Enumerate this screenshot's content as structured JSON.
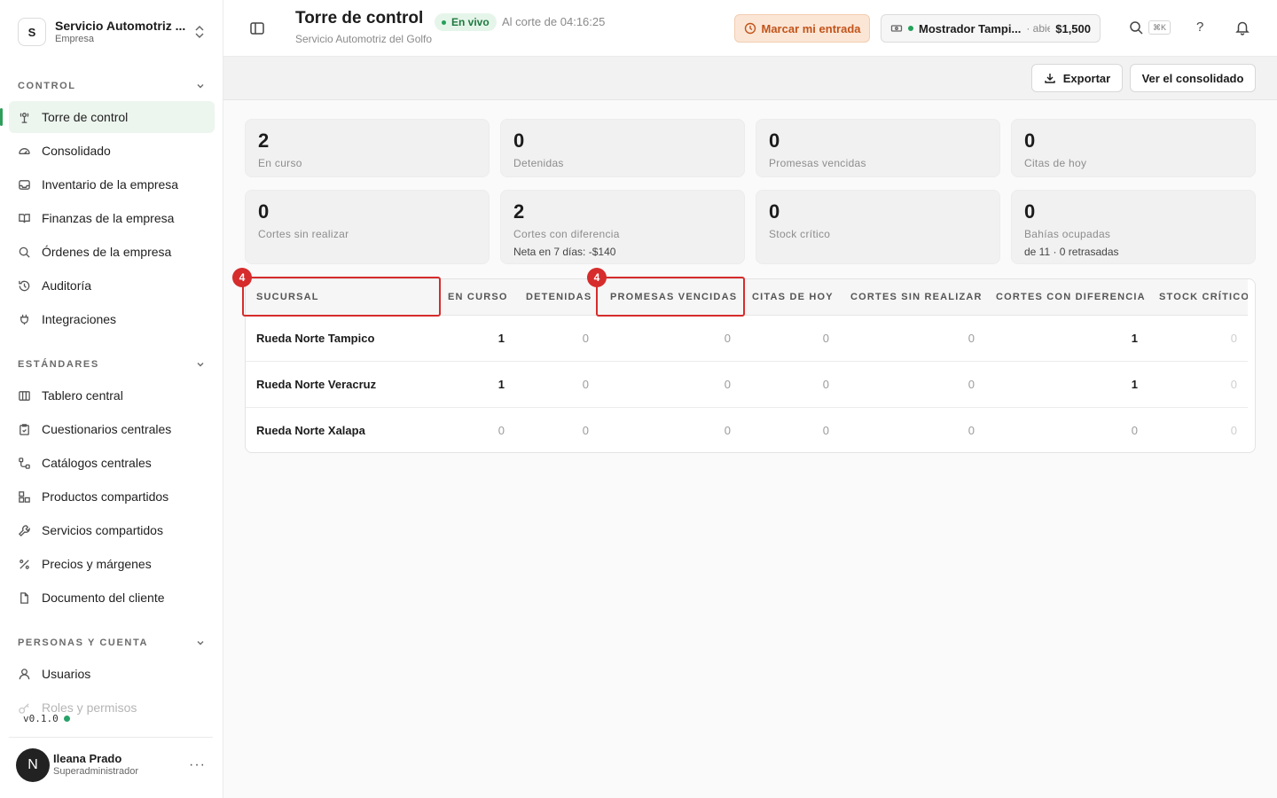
{
  "org": {
    "initial": "S",
    "name": "Servicio Automotriz ...",
    "type": "Empresa"
  },
  "sections": {
    "control": "CONTROL",
    "standards": "ESTÁNDARES",
    "people": "PERSONAS Y CUENTA"
  },
  "nav": {
    "control": [
      "Torre de control",
      "Consolidado",
      "Inventario de la empresa",
      "Finanzas de la empresa",
      "Órdenes de la empresa",
      "Auditoría",
      "Integraciones"
    ],
    "standards": [
      "Tablero central",
      "Cuestionarios centrales",
      "Catálogos centrales",
      "Productos compartidos",
      "Servicios compartidos",
      "Precios y márgenes",
      "Documento del cliente"
    ],
    "people": [
      "Usuarios",
      "Roles y permisos"
    ]
  },
  "version": "v0.1.0",
  "user": {
    "initial": "N",
    "name": "Ileana Prado",
    "role": "Superadministrador"
  },
  "header": {
    "title": "Torre de control",
    "live": "En vivo",
    "cut": "Al corte de 04:16:25",
    "subtitle": "Servicio Automotriz del Golfo",
    "checkin": "Marcar mi entrada",
    "register_name": "Mostrador Tampi...",
    "register_state": "· abierta",
    "register_amount": "$1,500",
    "shortcut": "⌘K",
    "help": "?"
  },
  "actions": {
    "export": "Exportar",
    "consolidated": "Ver el consolidado"
  },
  "stats": [
    {
      "value": "2",
      "label": "En curso"
    },
    {
      "value": "0",
      "label": "Detenidas"
    },
    {
      "value": "0",
      "label": "Promesas vencidas"
    },
    {
      "value": "0",
      "label": "Citas de hoy"
    },
    {
      "value": "0",
      "label": "Cortes sin realizar"
    },
    {
      "value": "2",
      "label": "Cortes con diferencia",
      "extra": "Neta en 7 días: -$140"
    },
    {
      "value": "0",
      "label": "Stock crítico"
    },
    {
      "value": "0",
      "label": "Bahías ocupadas",
      "extra": "de 11 · 0 retrasadas"
    }
  ],
  "table": {
    "columns": [
      "SUCURSAL",
      "EN CURSO",
      "DETENIDAS",
      "PROMESAS VENCIDAS",
      "CITAS DE HOY",
      "CORTES SIN REALIZAR",
      "CORTES CON DIFERENCIA",
      "STOCK CRÍTICO"
    ],
    "rows": [
      {
        "name": "Rueda Norte Tampico",
        "values": [
          "1",
          "0",
          "0",
          "0",
          "0",
          "1",
          "0"
        ]
      },
      {
        "name": "Rueda Norte Veracruz",
        "values": [
          "1",
          "0",
          "0",
          "0",
          "0",
          "1",
          "0"
        ]
      },
      {
        "name": "Rueda Norte Xalapa",
        "values": [
          "0",
          "0",
          "0",
          "0",
          "0",
          "0",
          "0"
        ]
      }
    ]
  },
  "annotations": {
    "badge_a": "4",
    "badge_b": "4"
  },
  "colors": {
    "accent": "#2f9e5b",
    "highlight": "#d62c2c",
    "warning": "#c2541a"
  }
}
